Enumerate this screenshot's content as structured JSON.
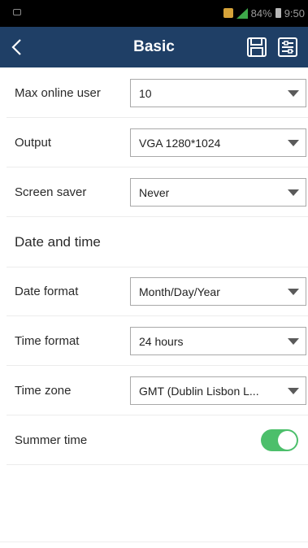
{
  "status_bar": {
    "battery": "84%",
    "time": "9:50"
  },
  "app_bar": {
    "title": "Basic",
    "back_icon": "chevron-left-icon",
    "save_icon": "floppy-disk-icon",
    "menu_icon": "list-settings-icon"
  },
  "settings": [
    {
      "label": "Max online user",
      "value": "10"
    },
    {
      "label": "Output",
      "value": "VGA 1280*1024"
    },
    {
      "label": "Screen saver",
      "value": "Never"
    }
  ],
  "date_time_section": {
    "title": "Date and time"
  },
  "date_time": [
    {
      "label": "Date format",
      "value": "Month/Day/Year"
    },
    {
      "label": "Time format",
      "value": "24 hours"
    },
    {
      "label": "Time zone",
      "value": "GMT (Dublin Lisbon L..."
    }
  ],
  "summer_time": {
    "label": "Summer time",
    "enabled": true
  },
  "colors": {
    "app_bar": "#1f3f66",
    "toggle_on": "#4cbf6b"
  }
}
